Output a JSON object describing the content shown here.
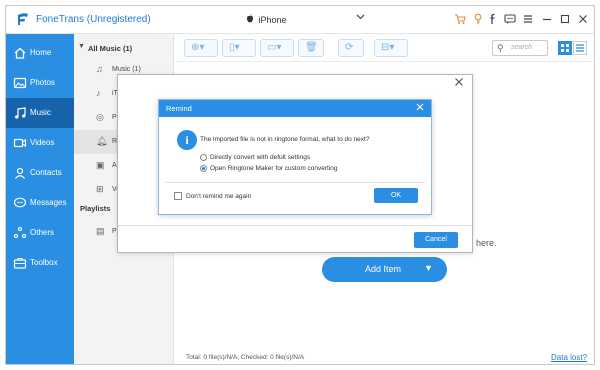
{
  "app": {
    "title": "FoneTrans (Unregistered)",
    "device_name": "iPhone",
    "accent_color": "#2a8ee2",
    "title_icons": [
      "cart-icon",
      "key-icon",
      "facebook-icon",
      "chat-icon",
      "menu-icon",
      "minimize-icon",
      "maximize-icon",
      "close-icon"
    ]
  },
  "sidebar": {
    "items": [
      {
        "label": "Home",
        "icon": "home-icon"
      },
      {
        "label": "Photos",
        "icon": "photos-icon"
      },
      {
        "label": "Music",
        "icon": "music-icon",
        "active": true
      },
      {
        "label": "Videos",
        "icon": "videos-icon"
      },
      {
        "label": "Contacts",
        "icon": "contacts-icon"
      },
      {
        "label": "Messages",
        "icon": "messages-icon"
      },
      {
        "label": "Others",
        "icon": "others-icon"
      },
      {
        "label": "Toolbox",
        "icon": "toolbox-icon"
      }
    ]
  },
  "categories": {
    "all_music_label": "All Music (1)",
    "items": [
      {
        "label": "Music (1)"
      },
      {
        "label": "iTu"
      },
      {
        "label": "Po"
      },
      {
        "label": "Ri",
        "active": true
      },
      {
        "label": "Au"
      },
      {
        "label": "Vo"
      }
    ],
    "playlists_label": "Playlists",
    "playlist_items": [
      {
        "label": "Pla"
      }
    ]
  },
  "search": {
    "placeholder": "search"
  },
  "main": {
    "empty_text": "here.",
    "add_item_label": "Add Item",
    "status_text": "Total: 0 file(s)/N/A; Checked: 0 file(s)/N/A",
    "data_lost_link": "Data lost?"
  },
  "outer_dialog": {
    "cancel_label": "Cancel"
  },
  "remind_dialog": {
    "title": "Remind",
    "message": "The imported file is not in ringtone format, what to do next?",
    "options": [
      {
        "label": "Directly convert with defult settings",
        "selected": false
      },
      {
        "label": "Open Ringtone Maker for custom converting",
        "selected": true
      }
    ],
    "dont_remind_label": "Don't remind me again",
    "ok_label": "OK"
  }
}
